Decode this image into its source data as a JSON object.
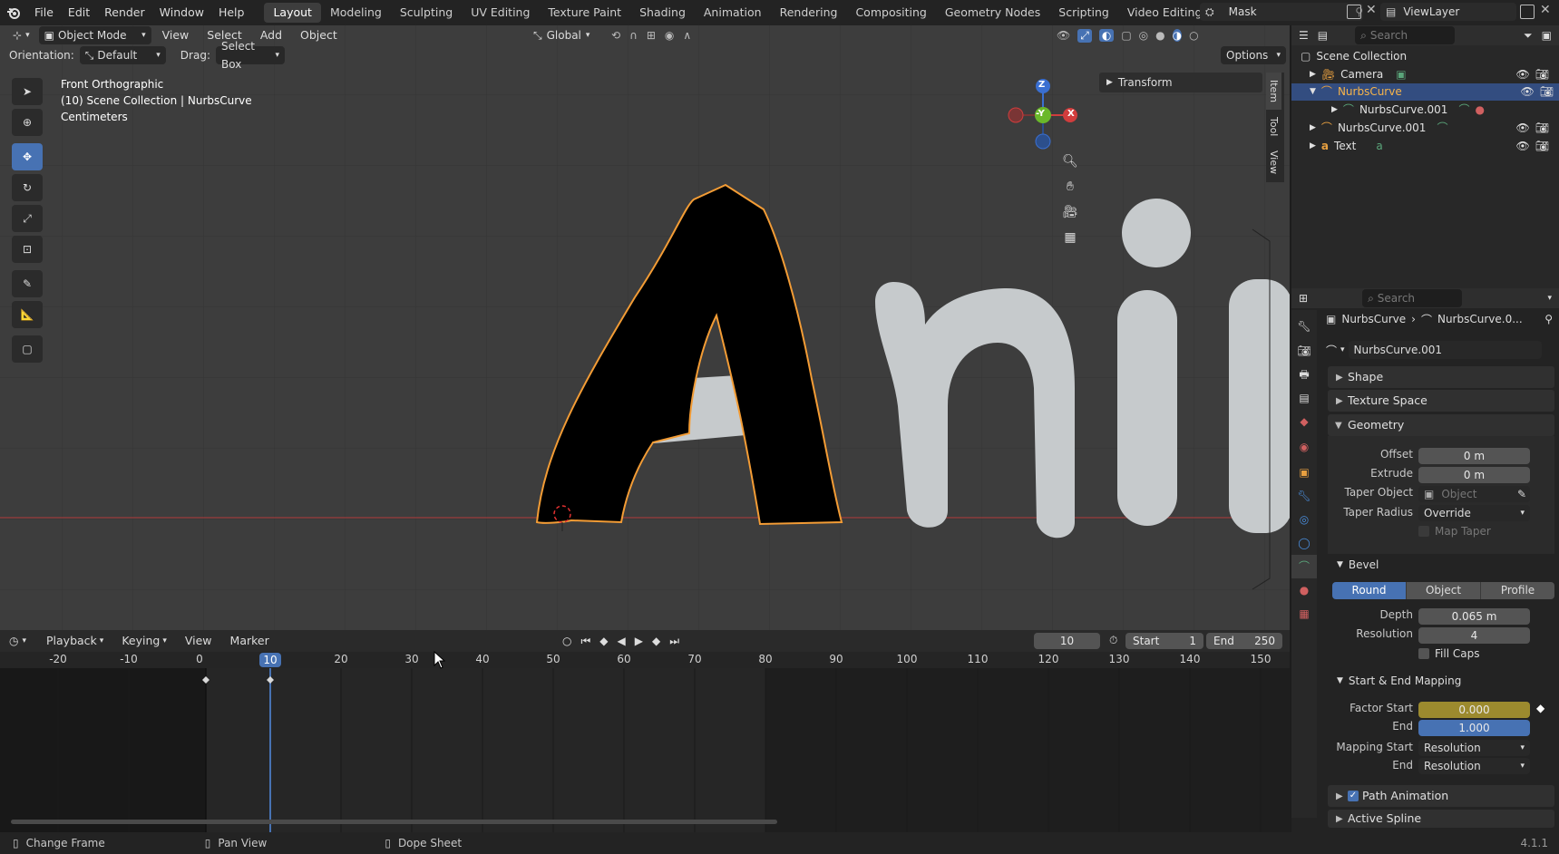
{
  "topbar": {
    "menus": [
      "File",
      "Edit",
      "Render",
      "Window",
      "Help"
    ],
    "workspaces": [
      "Layout",
      "Modeling",
      "Sculpting",
      "UV Editing",
      "Texture Paint",
      "Shading",
      "Animation",
      "Rendering",
      "Compositing",
      "Geometry Nodes",
      "Scripting",
      "Video Editing"
    ],
    "active_workspace": "Layout",
    "add_tab": "+",
    "scene_name": "Mask",
    "view_layer": "ViewLayer"
  },
  "viewport_header": {
    "mode": "Object Mode",
    "menus": [
      "View",
      "Select",
      "Add",
      "Object"
    ],
    "transform_orientation": "Global",
    "orientation_label": "Orientation:",
    "orientation_value": "Default",
    "drag_label": "Drag:",
    "drag_value": "Select Box",
    "options": "Options"
  },
  "viewport": {
    "view_name": "Front Orthographic",
    "collection_info": "(10) Scene Collection | NurbsCurve",
    "units": "Centimeters",
    "n_panel_tab": "Transform",
    "side_tabs": [
      "Item",
      "Tool",
      "View"
    ],
    "gizmo": {
      "z": "Z",
      "y": "-Y",
      "x": "X"
    },
    "letters": [
      "A",
      "n",
      "i",
      "i"
    ]
  },
  "outliner": {
    "search_placeholder": "Search",
    "root": "Scene Collection",
    "items": [
      {
        "label": "Camera",
        "selected": false
      },
      {
        "label": "NurbsCurve",
        "selected": true
      },
      {
        "label": "NurbsCurve.001",
        "selected": false,
        "child": true
      },
      {
        "label": "NurbsCurve.001",
        "selected": false
      },
      {
        "label": "Text",
        "selected": false
      }
    ]
  },
  "properties": {
    "search_placeholder": "Search",
    "breadcrumb_object": "NurbsCurve",
    "breadcrumb_data": "NurbsCurve.0...",
    "datablock": "NurbsCurve.001",
    "panels": {
      "shape": "Shape",
      "texture_space": "Texture Space",
      "geometry": "Geometry",
      "bevel": "Bevel",
      "start_end": "Start & End Mapping",
      "path_animation": "Path Animation",
      "active_spline": "Active Spline"
    },
    "geometry": {
      "offset_label": "Offset",
      "offset": "0 m",
      "extrude_label": "Extrude",
      "extrude": "0 m",
      "taper_object_label": "Taper Object",
      "taper_object_placeholder": "Object",
      "taper_radius_label": "Taper Radius",
      "taper_radius": "Override",
      "map_taper": "Map Taper"
    },
    "bevel": {
      "modes": [
        "Round",
        "Object",
        "Profile"
      ],
      "active_mode": "Round",
      "depth_label": "Depth",
      "depth": "0.065 m",
      "resolution_label": "Resolution",
      "resolution": "4",
      "fill_caps": "Fill Caps"
    },
    "start_end": {
      "factor_start_label": "Factor Start",
      "factor_start": "0.000",
      "end_label": "End",
      "end": "1.000",
      "mapping_start_label": "Mapping Start",
      "mapping_start": "Resolution",
      "mapping_end_label": "End",
      "mapping_end": "Resolution"
    }
  },
  "timeline": {
    "menus": [
      "Playback",
      "Keying",
      "View",
      "Marker"
    ],
    "current_frame": "10",
    "start_label": "Start",
    "start": "1",
    "end_label": "End",
    "end": "250",
    "ticks": [
      "-20",
      "-10",
      "0",
      "10",
      "20",
      "30",
      "40",
      "50",
      "60",
      "70",
      "80",
      "90",
      "100",
      "110",
      "120",
      "130",
      "140",
      "150"
    ]
  },
  "statusbar": {
    "change_frame": "Change Frame",
    "pan_view": "Pan View",
    "dope_sheet": "Dope Sheet",
    "version": "4.1.1"
  },
  "colors": {
    "accent": "#4772b3",
    "selected_orange": "#f39c35",
    "factor_start": "#9c8a2e",
    "grid_bg": "#3d3d3d"
  }
}
